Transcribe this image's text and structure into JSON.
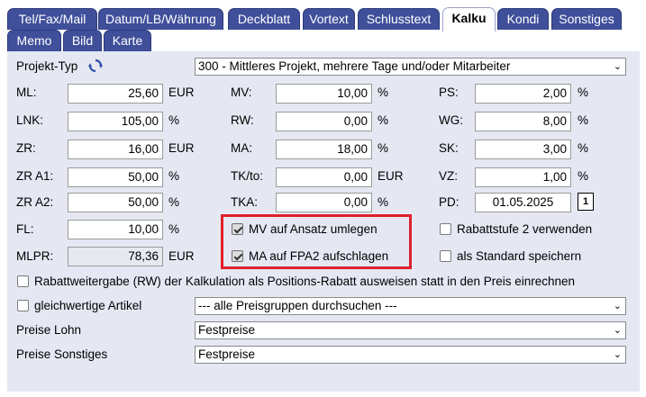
{
  "tabs_row1": [
    "Tel/Fax/Mail",
    "Datum/LB/Währung",
    "Deckblatt",
    "Vortext",
    "Schlusstext",
    "Kalku",
    "Kondi",
    "Sonstiges"
  ],
  "tabs_row2": [
    "Memo",
    "Bild",
    "Karte"
  ],
  "active_tab": "Kalku",
  "projekt_typ": {
    "label": "Projekt-Typ",
    "icon": "refresh-icon",
    "value": "300 - Mittleres Projekt, mehrere Tage und/oder Mitarbeiter"
  },
  "fields": {
    "ml": {
      "label": "ML:",
      "value": "25,60",
      "unit": "EUR"
    },
    "lnk": {
      "label": "LNK:",
      "value": "105,00",
      "unit": "%"
    },
    "zr": {
      "label": "ZR:",
      "value": "16,00",
      "unit": "EUR"
    },
    "zra1": {
      "label": "ZR A1:",
      "value": "50,00",
      "unit": "%"
    },
    "zra2": {
      "label": "ZR A2:",
      "value": "50,00",
      "unit": "%"
    },
    "fl": {
      "label": "FL:",
      "value": "10,00",
      "unit": "%"
    },
    "mlpr": {
      "label": "MLPR:",
      "value": "78,36",
      "unit": "EUR"
    },
    "mv": {
      "label": "MV:",
      "value": "10,00",
      "unit": "%"
    },
    "rw": {
      "label": "RW:",
      "value": "0,00",
      "unit": "%"
    },
    "ma": {
      "label": "MA:",
      "value": "18,00",
      "unit": "%"
    },
    "tkto": {
      "label": "TK/to:",
      "value": "0,00",
      "unit": "EUR"
    },
    "tka": {
      "label": "TKA:",
      "value": "0,00",
      "unit": "%"
    },
    "ps": {
      "label": "PS:",
      "value": "2,00",
      "unit": "%"
    },
    "wg": {
      "label": "WG:",
      "value": "8,00",
      "unit": "%"
    },
    "sk": {
      "label": "SK:",
      "value": "3,00",
      "unit": "%"
    },
    "vz": {
      "label": "VZ:",
      "value": "1,00",
      "unit": "%"
    },
    "pd": {
      "label": "PD:",
      "value": "01.05.2025",
      "button": "1"
    }
  },
  "checkboxes": {
    "mv_ansatz": {
      "label": "MV auf Ansatz umlegen",
      "checked": true
    },
    "ma_fpa2": {
      "label": "MA auf FPA2 aufschlagen",
      "checked": true
    },
    "rabattstufe2": {
      "label": "Rabattstufe 2 verwenden",
      "checked": false
    },
    "als_standard": {
      "label": "als Standard speichern",
      "checked": false
    },
    "rabattweitergabe": {
      "label": "Rabattweitergabe (RW) der Kalkulation als Positions-Rabatt ausweisen statt in den Preis einrechnen",
      "checked": false
    },
    "gleichwertige": {
      "label": "gleichwertige Artikel",
      "checked": false
    }
  },
  "preisgruppen_select": "--- alle Preisgruppen durchsuchen ---",
  "preise_lohn": {
    "label": "Preise Lohn",
    "value": "Festpreise"
  },
  "preise_sonstiges": {
    "label": "Preise Sonstiges",
    "value": "Festpreise"
  },
  "colors": {
    "tab_bg": "#3f4f9a",
    "panel_bg": "#e5e8f3",
    "highlight": "#e0202c"
  }
}
